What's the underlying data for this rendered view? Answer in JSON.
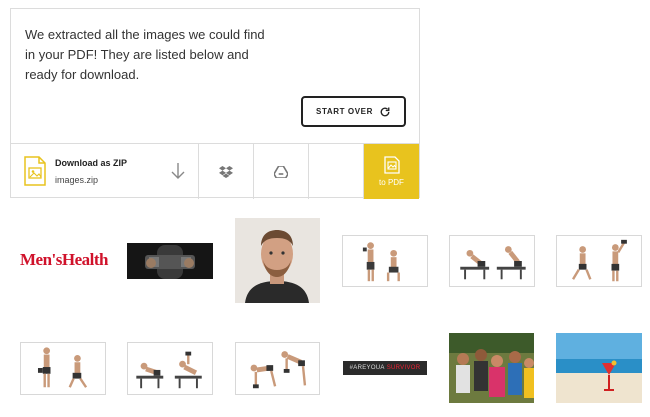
{
  "message": {
    "line1": "We extracted all the images we could find",
    "line2": "in your PDF! They are listed below and",
    "line3": "ready for download."
  },
  "start_over": {
    "label": "START OVER",
    "icon": "refresh-icon"
  },
  "download": {
    "title": "Download as ZIP",
    "filename": "images.zip",
    "icon": "zip-file-icon"
  },
  "actions": [
    {
      "icon": "download-arrow-icon"
    },
    {
      "icon": "dropbox-icon"
    },
    {
      "icon": "google-drive-icon"
    }
  ],
  "to_pdf": {
    "label": "to PDF",
    "icon": "image-to-pdf-icon"
  },
  "thumbnails": {
    "logo_text": "Men'sHealth",
    "banner_text": "#AREYOUA",
    "banner_highlight": "SURVIVOR"
  },
  "colors": {
    "accent": "#e8c31e",
    "logo_red": "#d0122b",
    "border": "#dcdcdc"
  }
}
